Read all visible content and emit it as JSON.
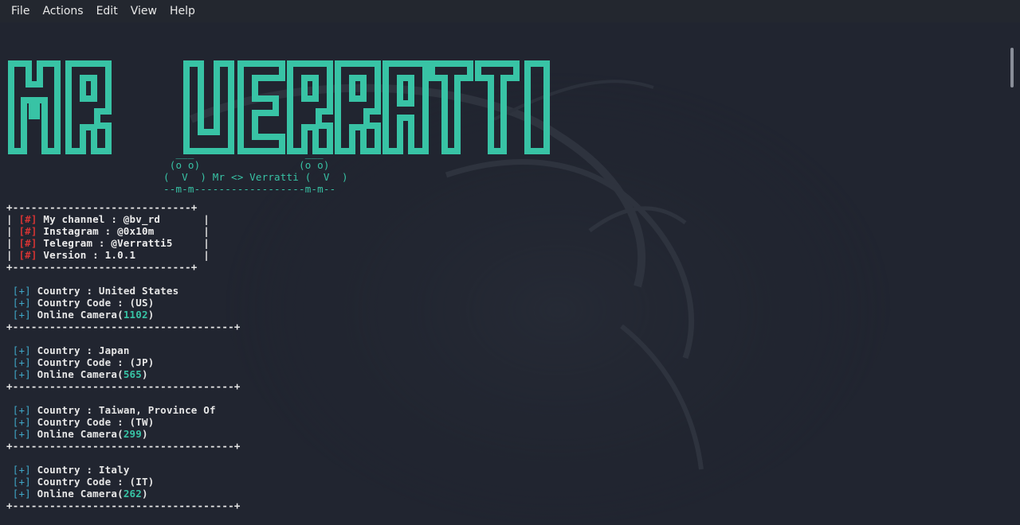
{
  "menu": [
    "File",
    "Actions",
    "Edit",
    "View",
    "Help"
  ],
  "banner": {
    "logo_text": "MR VERRATTI",
    "owl_line1": "  ___                  ___",
    "owl_line2": " (o o)                (o o)",
    "owl_line3": "(  V  ) Mr <> Verratti (  V  )",
    "owl_line4": "--m-m------------------m-m--"
  },
  "info": {
    "channel": "My channel : @bv_rd",
    "instagram": "Instagram : @0x10m",
    "telegram": "Telegram : @Verratti5",
    "version": "Version : 1.0.1"
  },
  "entries": [
    {
      "country": "Country : United States",
      "code": "Country Code : (US)",
      "cam_label": "Online Camera(",
      "count": "1102",
      "close": ")"
    },
    {
      "country": "Country : Japan",
      "code": "Country Code : (JP)",
      "cam_label": "Online Camera(",
      "count": "565",
      "close": ")"
    },
    {
      "country": "Country : Taiwan, Province Of",
      "code": "Country Code : (TW)",
      "cam_label": "Online Camera(",
      "count": "299",
      "close": ")"
    },
    {
      "country": "Country : Italy",
      "code": "Country Code : (IT)",
      "cam_label": "Online Camera(",
      "count": "262",
      "close": ")"
    }
  ],
  "tags": {
    "hash": "[#]",
    "plus": "[+]"
  },
  "colors": {
    "accent": "#38c3a5",
    "tag_red": "#d43434",
    "background": "#212530"
  }
}
